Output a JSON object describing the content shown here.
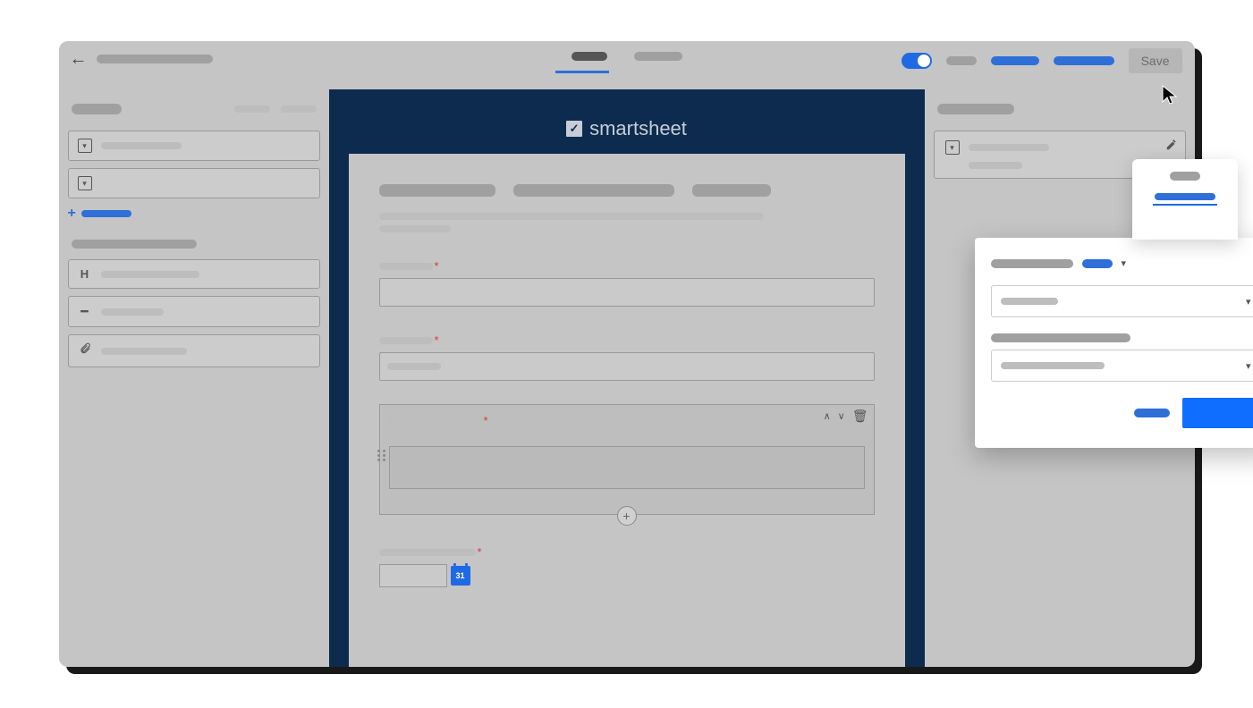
{
  "header": {
    "save_label": "Save",
    "tab1": "",
    "tab2": ""
  },
  "brand": {
    "name": "smartsheet"
  },
  "sidebar_left": {
    "items": [
      "",
      ""
    ],
    "add_label": "",
    "elements": [
      "",
      "",
      ""
    ]
  },
  "sidebar_right": {
    "card_line1": "",
    "card_line2": ""
  },
  "popover": {
    "tab_label": "",
    "link_label": "",
    "condition_prefix": "",
    "condition_value": "",
    "select1_value": "",
    "label2": "",
    "select2_value": "",
    "cancel": "",
    "confirm": ""
  },
  "form": {
    "field1_label": "",
    "field2_label": "",
    "field2_value": "",
    "field3_label": "",
    "field3_help": "",
    "field4_label": "",
    "calendar_day": "31"
  }
}
